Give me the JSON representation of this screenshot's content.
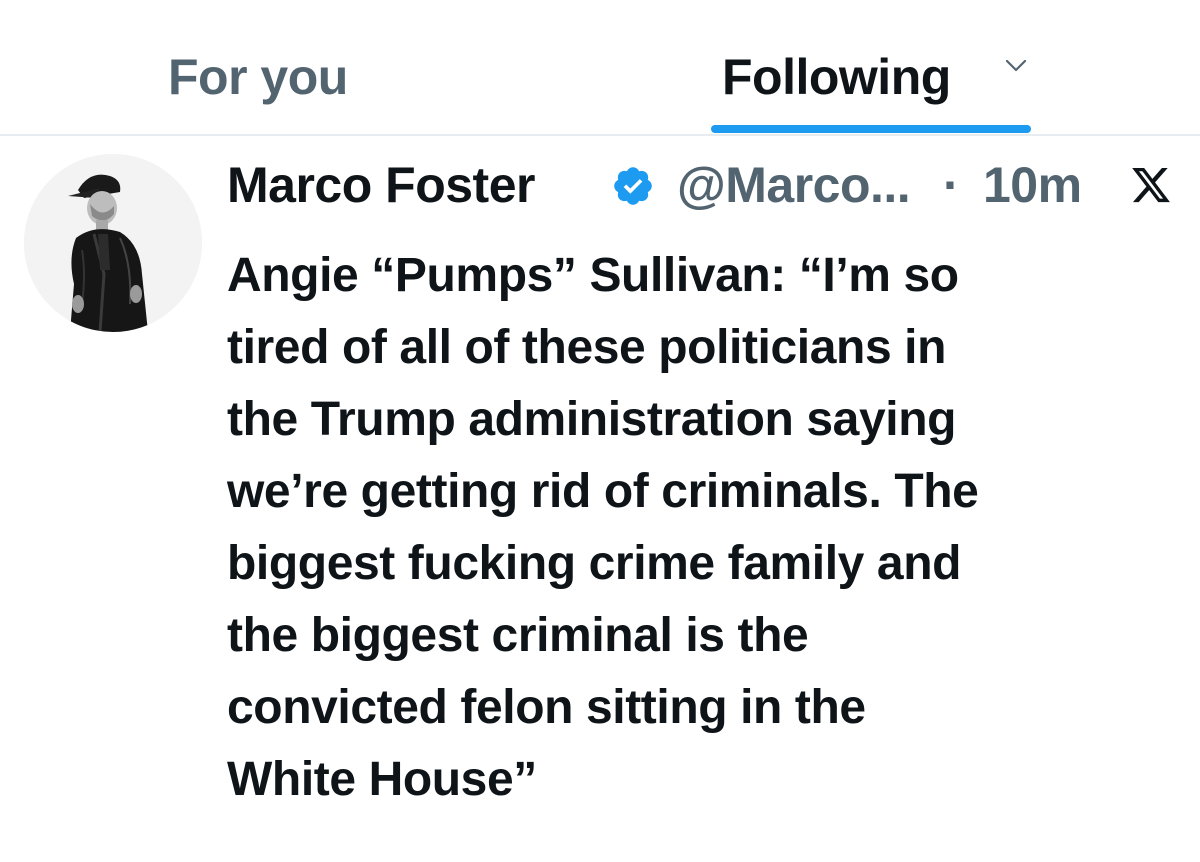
{
  "tabs": {
    "for_you": "For you",
    "following": "Following",
    "active": "following"
  },
  "post": {
    "author_name": "Marco Foster",
    "handle": "@Marco...",
    "separator": "·",
    "timestamp": "10m",
    "verified": true,
    "icons": {
      "verified": "verified-badge-icon",
      "x": "x-logo-icon",
      "tab_menu": "chevron-down-icon"
    },
    "text_lines": [
      "Angie “Pumps” Sullivan: “I’m so",
      "tired of all of these politicians in",
      "the Trump administration saying",
      "we’re getting rid of criminals. The",
      "biggest fucking crime family and",
      "the biggest criminal is the",
      "convicted felon sitting in the",
      "White House”"
    ]
  },
  "colors": {
    "accent": "#1d9bf0",
    "text_primary": "#0f1419",
    "text_secondary": "#536471",
    "divider": "#e6ecf0"
  }
}
